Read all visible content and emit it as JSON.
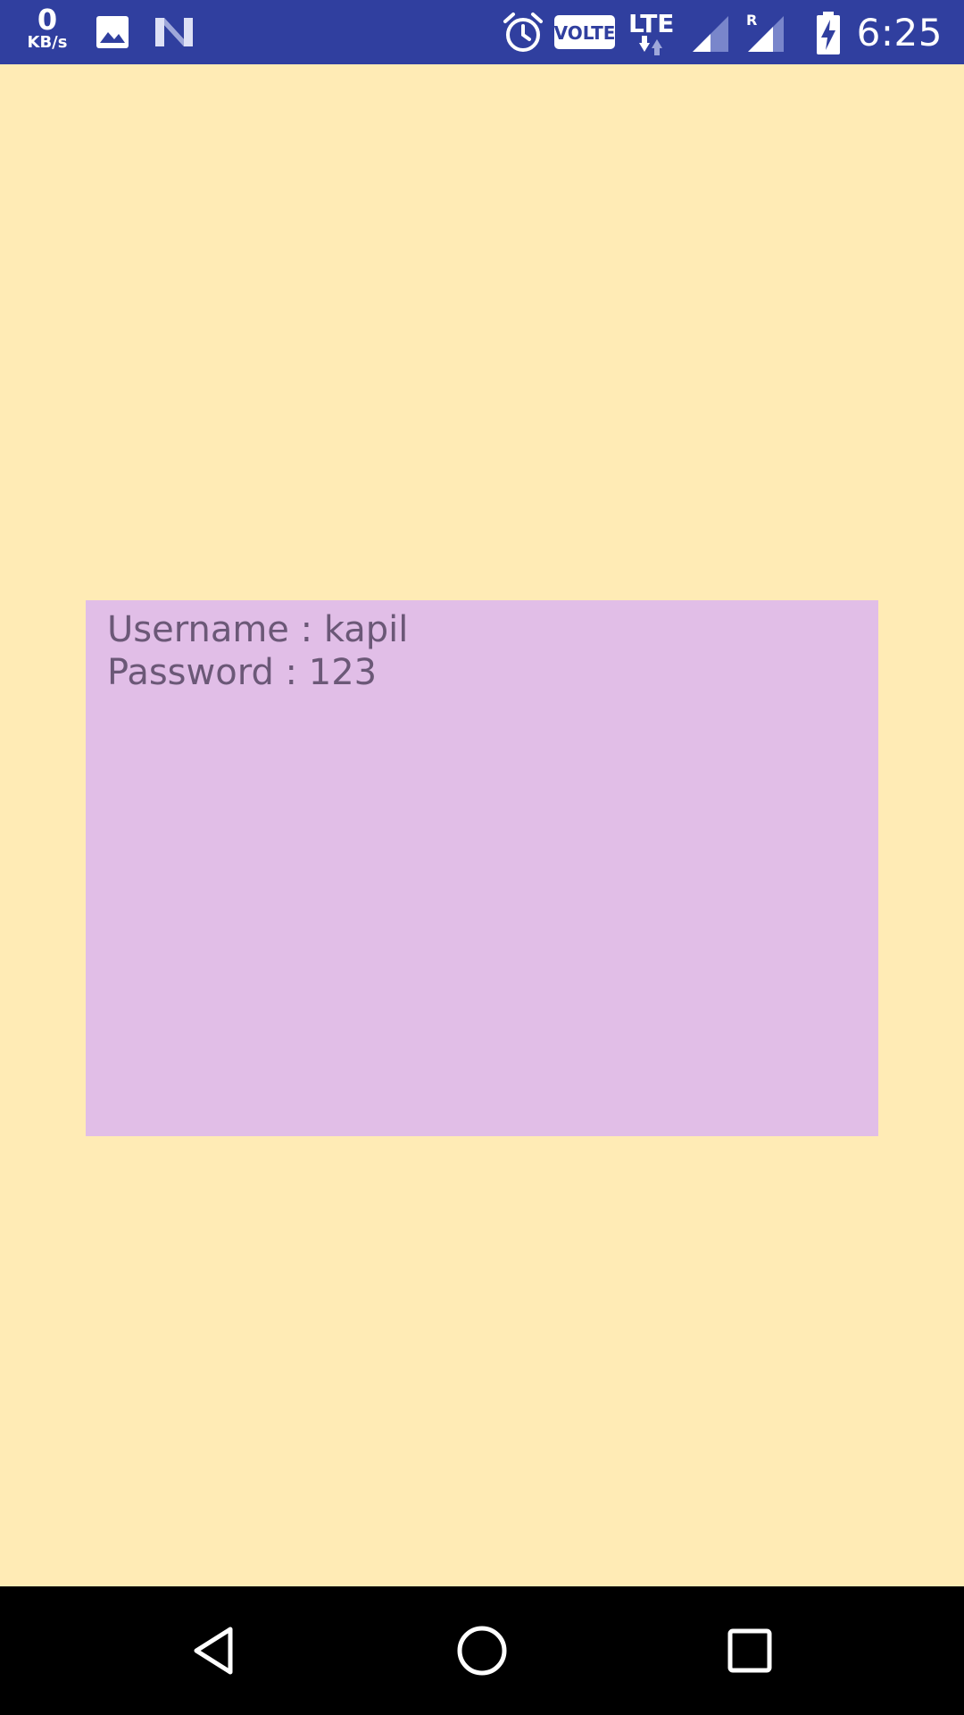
{
  "status_bar": {
    "net_speed_value": "0",
    "net_speed_unit": "KB/s",
    "volte_label": "VOLTE",
    "lte_label": "LTE",
    "roaming_label": "R",
    "time": "6:25",
    "bg_color": "#303F9F",
    "icons": [
      "image-icon",
      "n-icon",
      "alarm-icon",
      "volte-icon",
      "lte-icon",
      "signal-icon",
      "roaming-signal-icon",
      "battery-charging-icon"
    ]
  },
  "main": {
    "bg_color": "#FFEBB5",
    "card": {
      "bg_color": "#E1BEE7",
      "username_text": "Username : kapil",
      "password_text": "Password : 123"
    }
  },
  "nav_bar": {
    "icons": [
      "back-icon",
      "home-icon",
      "recents-icon"
    ]
  }
}
